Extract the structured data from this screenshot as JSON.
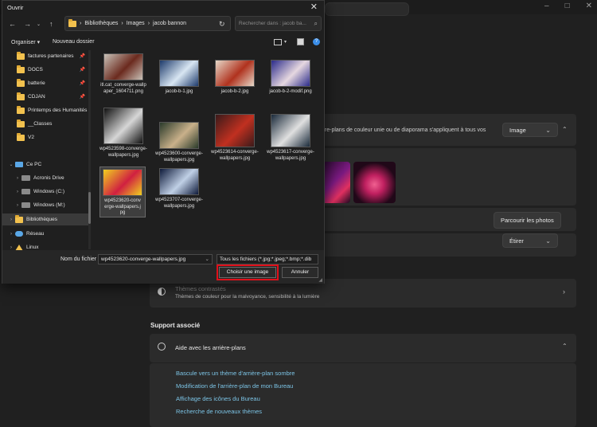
{
  "dialog": {
    "title": "Ouvrir",
    "breadcrumb": [
      "Bibliothèques",
      "Images",
      "jacob bannon"
    ],
    "search_placeholder": "Rechercher dans : jacob ba...",
    "toolbar": {
      "organize": "Organiser",
      "new_folder": "Nouveau dossier"
    },
    "sidebar": [
      {
        "label": "factures partenaires",
        "icon": "folder-icon",
        "pinned": true
      },
      {
        "label": "DOCS",
        "icon": "folder-icon",
        "pinned": true
      },
      {
        "label": "batterie",
        "icon": "folder-icon",
        "pinned": true
      },
      {
        "label": "CDJAN",
        "icon": "folder-icon",
        "pinned": true
      },
      {
        "label": "Printemps des Humanités",
        "icon": "folder-icon",
        "pinned": false
      },
      {
        "label": "__Classes",
        "icon": "folder-icon",
        "pinned": false
      },
      {
        "label": "V2",
        "icon": "folder-icon",
        "pinned": false
      },
      {
        "label": "Ce PC",
        "icon": "pc-icon",
        "pinned": false
      },
      {
        "label": "Acronis Drive",
        "icon": "drive-icon",
        "pinned": false
      },
      {
        "label": "Windows (C:)",
        "icon": "drive-icon",
        "pinned": false
      },
      {
        "label": "Windows (M:)",
        "icon": "drive-icon",
        "pinned": false
      },
      {
        "label": "Bibliothèques",
        "icon": "folder-icon",
        "pinned": false
      },
      {
        "label": "Réseau",
        "icon": "network-icon",
        "pinned": false
      },
      {
        "label": "Linux",
        "icon": "linux-icon",
        "pinned": false
      }
    ],
    "files": [
      {
        "name": "itl.cat_converge-wallpaper_1604711.png",
        "colors": [
          "#c9c2b8",
          "#6b2a1e"
        ]
      },
      {
        "name": "jacob-b-1.jpg",
        "colors": [
          "#1d3a6b",
          "#d8e6f2"
        ]
      },
      {
        "name": "jacob-b-2.jpg",
        "colors": [
          "#e6d8c8",
          "#b0321e"
        ]
      },
      {
        "name": "jacob-b-2-modif.png",
        "colors": [
          "#2a2a8a",
          "#e6d8e0"
        ]
      },
      {
        "name": "wp4523598-converge-wallpapers.jpg",
        "colors": [
          "#111111",
          "#d6d6d6"
        ]
      },
      {
        "name": "wp4523600-converge-wallpapers.jpg",
        "colors": [
          "#2a3a2a",
          "#c9b08a"
        ]
      },
      {
        "name": "wp4523614-converge-wallpapers.jpg",
        "colors": [
          "#3a1a1a",
          "#c03020"
        ]
      },
      {
        "name": "wp4523617-converge-wallpapers.jpg",
        "colors": [
          "#1a2a3a",
          "#e0e0e0"
        ]
      },
      {
        "name": "wp4523620-converge-wallpapers.jpg",
        "colors": [
          "#f0d020",
          "#d02040"
        ],
        "selected": true
      },
      {
        "name": "wp4523707-converge-wallpapers.jpg",
        "colors": [
          "#0e1a3a",
          "#c0d0e6"
        ]
      }
    ],
    "filename_label": "Nom du fichier :",
    "filename_value": "wp4523620-converge-wallpapers.jpg",
    "filter_value": "Tous les fichiers (*.jpg;*.jpeg;*.bmp;*.dib",
    "open_button": "Choisir une image",
    "cancel_button": "Annuler"
  },
  "settings": {
    "apply_text": "ère-plans de couleur unie ou de diaporama s'appliquent à tous vos",
    "type_select": "Image",
    "browse_button": "Parcourir les photos",
    "fit_select": "Étirer",
    "contrast_title": "Thèmes contrastés",
    "contrast_desc": "Thèmes de couleur pour la malvoyance, sensibilité à la lumière",
    "support_title": "Support associé",
    "help_title": "Aide avec les arrière-plans",
    "links": [
      "Bascule vers un thème d'arrière-plan sombre",
      "Modification de l'arrière-plan de mon Bureau",
      "Affichage des icônes du Bureau",
      "Recherche de nouveaux thèmes"
    ]
  }
}
